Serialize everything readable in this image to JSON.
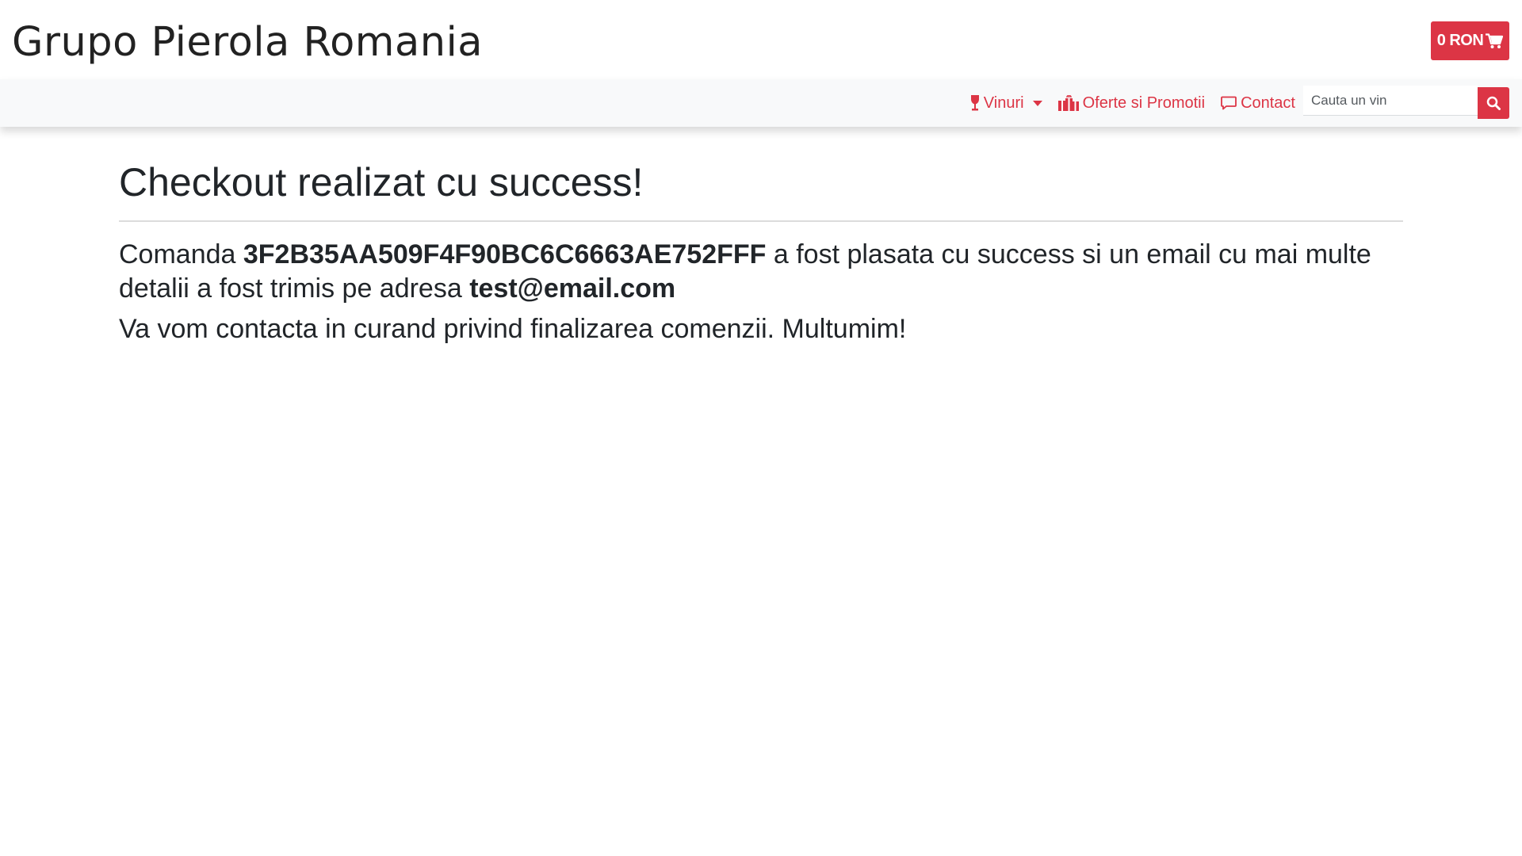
{
  "header": {
    "brand": "Grupo Pierola Romania",
    "cart_total": "0 RON",
    "cart_icon": "shopping-cart-icon"
  },
  "nav": {
    "wines_label": "Vinuri",
    "wines_icon": "wine-glass-icon",
    "offers_label": "Oferte si Promotii",
    "offers_icon": "gifts-icon",
    "contact_label": "Contact",
    "contact_icon": "comment-icon",
    "search_placeholder": "Cauta un vin",
    "search_icon": "search-icon"
  },
  "content": {
    "title": "Checkout realizat cu success!",
    "order_prefix": "Comanda ",
    "order_id": "3F2B35AA509F4F90BC6C6663AE752FFF",
    "order_middle": " a fost plasata cu success si un email cu mai multe detalii a fost trimis pe adresa ",
    "email": "test@email.com",
    "closing": "Va vom contacta in curand privind finalizarea comenzii. Multumim!"
  },
  "colors": {
    "accent": "#dc3545",
    "navbar_bg": "#f8f9fa",
    "text": "#212529"
  }
}
